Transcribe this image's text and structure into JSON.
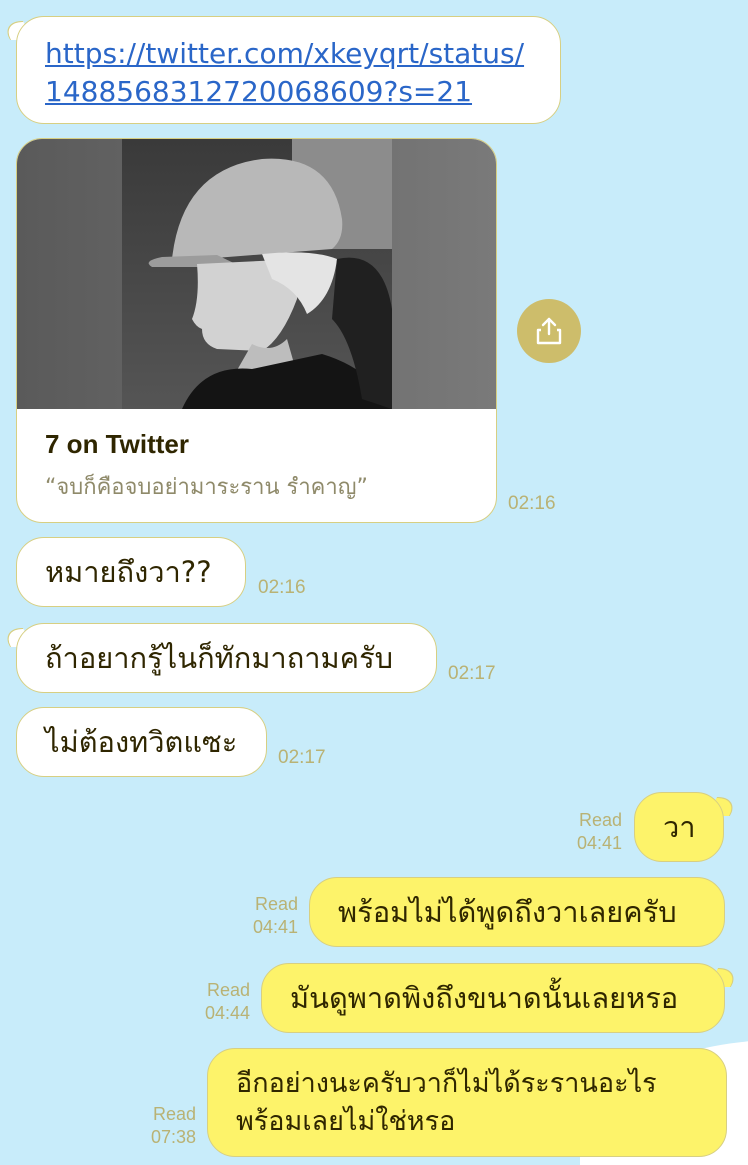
{
  "link_message": {
    "line1": "https://twitter.com/xkeyqrt/status/",
    "line2": "1488568312720068609?s=21"
  },
  "preview_card": {
    "title": "7 on Twitter",
    "description": "“จบก็คือจบอย่ามาระราน รำคาญ”",
    "time": "02:16",
    "share_icon": "share-icon"
  },
  "messages_incoming": [
    {
      "text": "หมายถึงวา??",
      "time": "02:16"
    },
    {
      "text": "ถ้าอยากรู้ไนก็ทักมาถามครับ",
      "time": "02:17"
    },
    {
      "text": "ไม่ต้องทวิตแซะ",
      "time": "02:17"
    }
  ],
  "messages_outgoing": [
    {
      "text": "วา",
      "status": "Read",
      "time": "04:41"
    },
    {
      "text": "พร้อมไม่ได้พูดถึงวาเลยครับ",
      "status": "Read",
      "time": "04:41"
    },
    {
      "text": "มันดูพาดพิงถึงขนาดนั้นเลยหรอ",
      "status": "Read",
      "time": "04:44"
    },
    {
      "line1": "อีกอย่างนะครับวาก็ไม่ได้ระรานอะไร",
      "line2": "พร้อมเลยไม่ใช่หรอ",
      "status": "Read",
      "time": "07:38"
    }
  ],
  "colors": {
    "background": "#c8ecfa",
    "incoming_bubble": "#ffffff",
    "outgoing_bubble": "#fdf36a",
    "bubble_border": "#d7cf82",
    "link": "#2a66c8",
    "timestamp": "#b9b274"
  }
}
